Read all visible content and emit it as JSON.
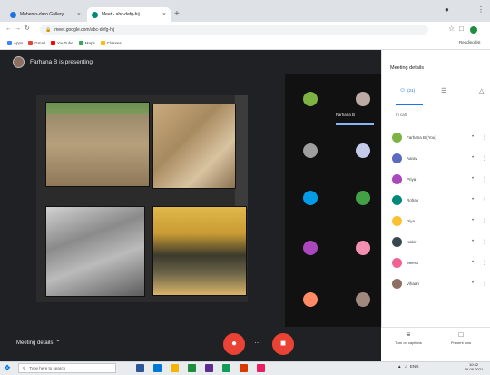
{
  "browser": {
    "tabs": [
      {
        "title": "Mohenjo-daro Gallery",
        "active": false,
        "favicon_color": "#1a73e8"
      },
      {
        "title": "Meet - abc-defg-hij",
        "active": true,
        "favicon_color": "#00897b"
      }
    ],
    "new_tab_glyph": "+",
    "url": "meet.google.com/abc-defg-hij",
    "bookmarks": [
      {
        "label": "Apps",
        "color": "#4285f4"
      },
      {
        "label": "Gmail",
        "color": "#ea4335"
      },
      {
        "label": "YouTube",
        "color": "#ff0000"
      },
      {
        "label": "Maps",
        "color": "#34a853"
      },
      {
        "label": "Classes",
        "color": "#fbbc04"
      }
    ],
    "reading_list": "Reading list"
  },
  "meet": {
    "presenter_label": "Farhana B is presenting",
    "you_label": "Farhana B",
    "meeting_details": "Meeting details",
    "participant_tiles": [
      {
        "color": "#7cb342"
      },
      {
        "color": "#bcaaa4"
      },
      {
        "color": "#9e9e9e"
      },
      {
        "color": "#c5cae9"
      },
      {
        "color": "#039be5"
      },
      {
        "color": "#43a047"
      },
      {
        "color": "#ab47bc"
      },
      {
        "color": "#f48fb1"
      },
      {
        "color": "#ff8a65"
      },
      {
        "color": "#a1887f"
      }
    ],
    "controls": {
      "mic_icon": "mic-off-icon",
      "cam_icon": "camera-off-icon",
      "end_icon": "end-call-icon"
    }
  },
  "panel": {
    "title": "Meeting details",
    "tabs": [
      {
        "icon": "people-icon",
        "glyph": "☺",
        "label": "(21)"
      },
      {
        "icon": "chat-icon",
        "glyph": "☰",
        "label": ""
      },
      {
        "icon": "activities-icon",
        "glyph": "△",
        "label": ""
      }
    ],
    "subheading": "In call",
    "participants": [
      {
        "name": "Farhana B (You)",
        "color": "#7cb342"
      },
      {
        "name": "Aarav",
        "color": "#5c6bc0"
      },
      {
        "name": "Priya",
        "color": "#ab47bc"
      },
      {
        "name": "Rohan",
        "color": "#00897b"
      },
      {
        "name": "Diya",
        "color": "#fbc02d"
      },
      {
        "name": "Kabir",
        "color": "#37474f"
      },
      {
        "name": "Meera",
        "color": "#f06292"
      },
      {
        "name": "Vihaan",
        "color": "#8d6e63"
      }
    ],
    "footer": [
      {
        "label": "Turn on captions",
        "icon": "captions-icon",
        "glyph": "≡"
      },
      {
        "label": "Present now",
        "icon": "present-icon",
        "glyph": "□"
      }
    ]
  },
  "taskbar": {
    "search_placeholder": "Type here to search",
    "apps": [
      "#2b579a",
      "#0078d7",
      "#f4b400",
      "#1e8e3e",
      "#5c2d91",
      "#0f9d58",
      "#d83b01",
      "#e91e63"
    ],
    "tray_text": "ENG",
    "time": "10:32",
    "date": "09-08-2021"
  }
}
